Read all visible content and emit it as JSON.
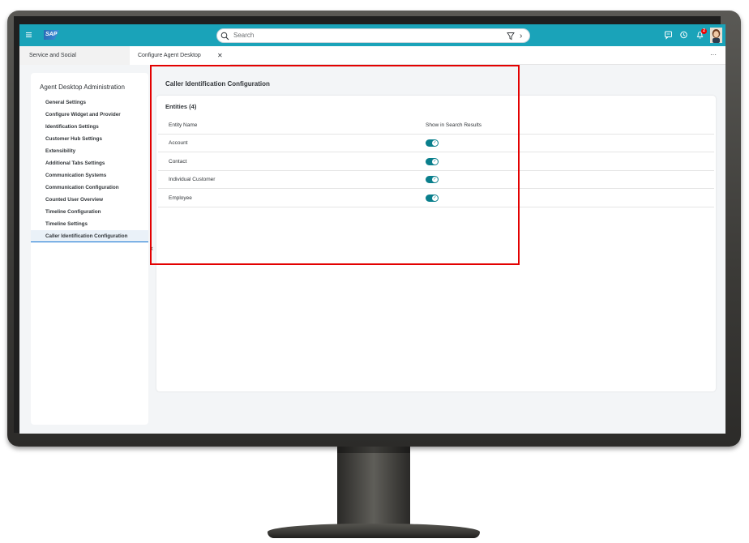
{
  "shell": {
    "logo_text": "SAP",
    "search_placeholder": "Search",
    "notification_count": "2",
    "accent": "#1aa3b9"
  },
  "tabs": [
    {
      "label": "Service and Social"
    },
    {
      "label": "Configure Agent Desktop"
    }
  ],
  "nav": {
    "title": "Agent Desktop Administration",
    "items": [
      {
        "label": "General Settings"
      },
      {
        "label": "Configure Widget and Provider"
      },
      {
        "label": "Identification Settings"
      },
      {
        "label": "Customer Hub Settings"
      },
      {
        "label": "Extensibility"
      },
      {
        "label": "Additional Tabs Settings"
      },
      {
        "label": "Communication Systems"
      },
      {
        "label": "Communication Configuration"
      },
      {
        "label": "Counted User Overview"
      },
      {
        "label": "Timeline Configuration"
      },
      {
        "label": "Timeline Settings"
      },
      {
        "label": "Caller Identification Configuration"
      }
    ],
    "active_index": 11
  },
  "main": {
    "title": "Caller Identification Configuration",
    "entities_title": "Entities (4)",
    "columns": [
      "Entity Name",
      "Show in Search Results"
    ],
    "rows": [
      {
        "name": "Account",
        "show": true
      },
      {
        "name": "Contact",
        "show": true
      },
      {
        "name": "Individual Customer",
        "show": true
      },
      {
        "name": "Employee",
        "show": true
      }
    ],
    "switch_color": "#0a7f8c"
  },
  "annotation": {
    "highlight_color": "#e30000"
  }
}
